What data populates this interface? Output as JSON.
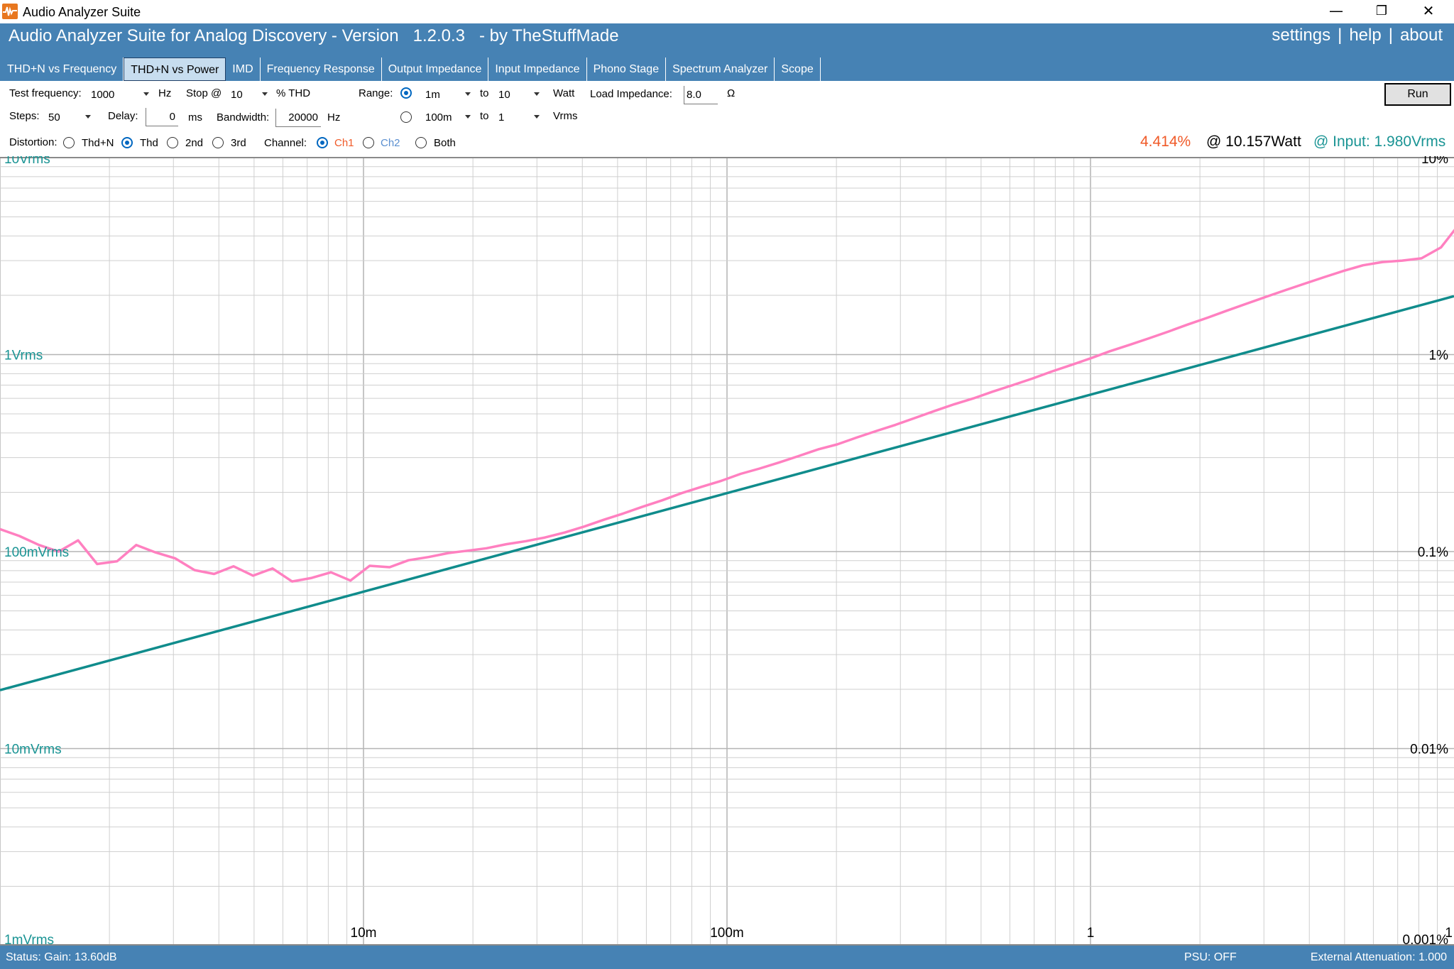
{
  "window": {
    "title": "Audio Analyzer Suite",
    "minimize": "—",
    "restore": "❐",
    "close": "✕"
  },
  "header": {
    "heading": "Audio Analyzer Suite for Analog Discovery - Version   1.2.0.3   - by TheStuffMade",
    "nav": {
      "settings": "settings",
      "sep": "|",
      "help": "help",
      "about": "about"
    }
  },
  "tabs": [
    {
      "label": "THD+N vs Frequency",
      "active": false
    },
    {
      "label": "THD+N vs Power",
      "active": true
    },
    {
      "label": "IMD",
      "active": false
    },
    {
      "label": "Frequency Response",
      "active": false
    },
    {
      "label": "Output Impedance",
      "active": false
    },
    {
      "label": "Input Impedance",
      "active": false
    },
    {
      "label": "Phono Stage",
      "active": false
    },
    {
      "label": "Spectrum Analyzer",
      "active": false
    },
    {
      "label": "Scope",
      "active": false
    }
  ],
  "controls": {
    "test_frequency_label": "Test frequency:",
    "test_frequency_value": "1000",
    "hz_unit": "Hz",
    "stop_label": "Stop @",
    "stop_value": "10",
    "thd_unit": "% THD",
    "range_label": "Range:",
    "range_watt_from": "1m",
    "range_watt_to": "10",
    "to_label": "to",
    "watt_unit": "Watt",
    "range_vrms_from": "100m",
    "range_vrms_to": "1",
    "vrms_unit": "Vrms",
    "load_impedance_label": "Load Impedance:",
    "load_impedance_value": "8.0",
    "ohm_unit": "Ω",
    "steps_label": "Steps:",
    "steps_value": "50",
    "delay_label": "Delay:",
    "delay_value": "0",
    "ms_unit": "ms",
    "bandwidth_label": "Bandwidth:",
    "bandwidth_value": "20000",
    "bandwidth_unit": "Hz",
    "distortion_label": "Distortion:",
    "distortion_options": [
      "Thd+N",
      "Thd",
      "2nd",
      "3rd"
    ],
    "distortion_selected": "Thd",
    "channel_label": "Channel:",
    "channel_options": [
      "Ch1",
      "Ch2",
      "Both"
    ],
    "channel_selected": "Ch1",
    "run_label": "Run"
  },
  "readout": {
    "thd": "4.414%",
    "power": "@ 10.157Watt",
    "input": "@ Input: 1.980Vrms"
  },
  "colors": {
    "header_bg": "#4682b4",
    "thd_curve": "#ff80c0",
    "input_curve": "#108c8c",
    "readout_thd": "#f05a28",
    "readout_input": "#1a9494",
    "ch1": "#f05a28",
    "ch2": "#5a8fd0"
  },
  "chart_data": {
    "type": "line",
    "xscale": "log",
    "yscale": "log",
    "xlim": [
      0.001,
      10
    ],
    "xlabel": "",
    "x_ticks": [
      "10m",
      "100m",
      "1",
      "1"
    ],
    "y_left_ticks": [
      "10Vrms",
      "1Vrms",
      "100mVrms",
      "10mVrms",
      "1mVrms"
    ],
    "y_right_ticks": [
      "10%",
      "1%",
      "0.1%",
      "0.01%",
      "0.001%"
    ],
    "ylim_percent": [
      0.001,
      10
    ],
    "ylim_vrms": [
      0.001,
      10
    ],
    "grid": true,
    "series": [
      {
        "axis": "right",
        "color": "#ff80c0",
        "x": [
          0.001,
          0.00113,
          0.00128,
          0.00145,
          0.00164,
          0.00185,
          0.0021,
          0.00237,
          0.00268,
          0.00303,
          0.00343,
          0.00388,
          0.00439,
          0.00497,
          0.00562,
          0.00636,
          0.0072,
          0.00814,
          0.00921,
          0.0104,
          0.0118,
          0.0133,
          0.0151,
          0.0171,
          0.0193,
          0.0218,
          0.0247,
          0.028,
          0.0316,
          0.0358,
          0.0405,
          0.0458,
          0.0518,
          0.0586,
          0.0663,
          0.075,
          0.0849,
          0.096,
          0.109,
          0.123,
          0.139,
          0.157,
          0.178,
          0.201,
          0.228,
          0.258,
          0.291,
          0.33,
          0.373,
          0.422,
          0.477,
          0.54,
          0.611,
          0.691,
          0.782,
          0.885,
          1.0,
          1.13,
          1.28,
          1.45,
          1.64,
          1.85,
          2.1,
          2.37,
          2.68,
          3.03,
          3.43,
          3.88,
          4.39,
          4.97,
          5.62,
          6.36,
          7.2,
          8.14,
          9.21,
          10.157
        ],
        "y": [
          0.13,
          0.12,
          0.108,
          0.1,
          0.114,
          0.0865,
          0.0893,
          0.108,
          0.099,
          0.0925,
          0.0805,
          0.077,
          0.0842,
          0.0755,
          0.0821,
          0.0705,
          0.0735,
          0.0785,
          0.0713,
          0.0847,
          0.0833,
          0.0904,
          0.0938,
          0.0983,
          0.101,
          0.104,
          0.109,
          0.113,
          0.118,
          0.125,
          0.134,
          0.145,
          0.156,
          0.169,
          0.182,
          0.198,
          0.213,
          0.228,
          0.248,
          0.264,
          0.283,
          0.305,
          0.33,
          0.35,
          0.38,
          0.41,
          0.44,
          0.478,
          0.518,
          0.56,
          0.6,
          0.65,
          0.7,
          0.755,
          0.82,
          0.885,
          0.957,
          1.04,
          1.12,
          1.21,
          1.31,
          1.42,
          1.54,
          1.67,
          1.81,
          1.96,
          2.12,
          2.29,
          2.47,
          2.66,
          2.84,
          2.95,
          3.0,
          3.08,
          3.5,
          4.414
        ]
      },
      {
        "axis": "left",
        "color": "#108c8c",
        "x": [
          0.001,
          10
        ],
        "y": [
          0.0198,
          1.98
        ]
      }
    ]
  },
  "status": {
    "gain": "Status: Gain: 13.60dB",
    "psu": "PSU: OFF",
    "attenuation": "External Attenuation: 1.000"
  }
}
